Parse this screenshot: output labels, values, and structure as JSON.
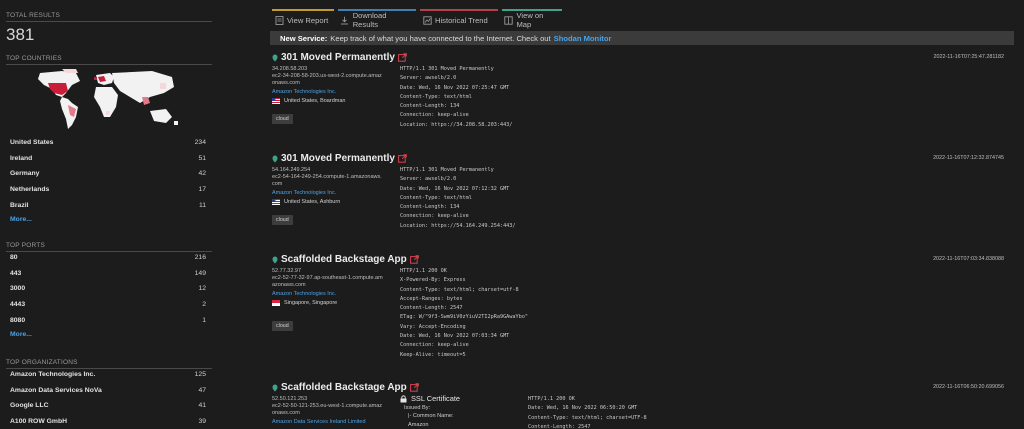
{
  "sidebar": {
    "total_results_title": "TOTAL RESULTS",
    "total_results_value": "381",
    "top_countries_title": "TOP COUNTRIES",
    "countries": [
      {
        "name": "United States",
        "count": "234"
      },
      {
        "name": "Ireland",
        "count": "51"
      },
      {
        "name": "Germany",
        "count": "42"
      },
      {
        "name": "Netherlands",
        "count": "17"
      },
      {
        "name": "Brazil",
        "count": "11"
      }
    ],
    "countries_more": "More...",
    "top_ports_title": "TOP PORTS",
    "ports": [
      {
        "name": "80",
        "count": "216"
      },
      {
        "name": "443",
        "count": "149"
      },
      {
        "name": "3000",
        "count": "12"
      },
      {
        "name": "4443",
        "count": "2"
      },
      {
        "name": "8080",
        "count": "1"
      }
    ],
    "ports_more": "More...",
    "top_orgs_title": "TOP ORGANIZATIONS",
    "orgs": [
      {
        "name": "Amazon Technologies Inc.",
        "count": "125"
      },
      {
        "name": "Amazon Data Services NoVa",
        "count": "47"
      },
      {
        "name": "Google LLC",
        "count": "41"
      },
      {
        "name": "A100 ROW GmbH",
        "count": "39"
      }
    ]
  },
  "toolbar": {
    "view_report": "View Report",
    "download_results": "Download Results",
    "historical_trend": "Historical Trend",
    "view_on_map": "View on Map"
  },
  "banner": {
    "bold": "New Service:",
    "text": "Keep track of what you have connected to the Internet. Check out",
    "link": "Shodan Monitor"
  },
  "results": [
    {
      "title": "301 Moved Permanently",
      "timestamp": "2022-11-16T07:25:47.281182",
      "ip": "34.208.58.203",
      "hostname": "ec2-34-208-58-203.us-west-2.compute.amazonaws.com",
      "org": "Amazon Technologies Inc.",
      "location": "United States, Boardman",
      "tag": "cloud",
      "banner": "HTTP/1.1 301 Moved Permanently\nServer: awselb/2.0\nDate: Wed, 16 Nov 2022 07:25:47 GMT\nContent-Type: text/html\nContent-Length: 134\nConnection: keep-alive\nLocation: https://34.208.58.203:443/"
    },
    {
      "title": "301 Moved Permanently",
      "timestamp": "2022-11-16T07:12:32.874745",
      "ip": "54.164.249.254",
      "hostname": "ec2-54-164-249-254.compute-1.amazonaws.com",
      "org": "Amazon Technologies Inc.",
      "location": "United States, Ashburn",
      "tag": "cloud",
      "banner": "HTTP/1.1 301 Moved Permanently\nServer: awselb/2.0\nDate: Wed, 16 Nov 2022 07:12:32 GMT\nContent-Type: text/html\nContent-Length: 134\nConnection: keep-alive\nLocation: https://54.164.249.254:443/"
    },
    {
      "title": "Scaffolded Backstage App",
      "timestamp": "2022-11-16T07:03:34.838088",
      "ip": "52.77.32.97",
      "hostname": "ec2-52-77-32-97.ap-southeast-1.compute.amazonaws.com",
      "org": "Amazon Technologies Inc.",
      "location": "Singapore, Singapore",
      "tag": "cloud",
      "banner": "HTTP/1.1 200 OK\nX-Powered-By: Express\nContent-Type: text/html; charset=utf-8\nAccept-Ranges: bytes\nContent-Length: 2547\nETag: W/\"9f3-Swm9iV0zYiuV2TI2pRa9GAwaYbo\"\nVary: Accept-Encoding\nDate: Wed, 16 Nov 2022 07:03:34 GMT\nConnection: keep-alive\nKeep-Alive: timeout=5"
    },
    {
      "title": "Scaffolded Backstage App",
      "timestamp": "2022-11-16T06:50:20.699056",
      "ip": "52.50.121.253",
      "hostname": "ec2-52-50-121-253.eu-west-1.compute.amazonaws.com",
      "org": "Amazon Data Services Ireland Limited",
      "ssl_title": "SSL Certificate",
      "ssl_issued_by": "Issued By:",
      "ssl_common_name": "|- Common Name:",
      "ssl_cn_value": "Amazon",
      "banner": "HTTP/1.1 200 OK\nDate: Wed, 16 Nov 2022 06:50:20 GMT\nContent-Type: text/html; charset=UTF-8\nContent-Length: 2547"
    }
  ],
  "colors": {
    "accent_link": "#4aa3e8",
    "tab_report": "#c49a2a",
    "tab_download": "#3f7fb3",
    "tab_trend": "#b5424a",
    "tab_map": "#3fa38b",
    "map_highlight": "#c81e3a"
  },
  "icons": [
    "report-icon",
    "download-icon",
    "trend-icon",
    "map-icon",
    "external-link-icon",
    "service-dot-icon",
    "lock-icon"
  ]
}
